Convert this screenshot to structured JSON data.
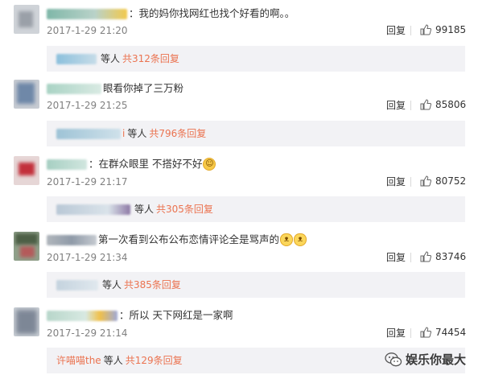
{
  "comments": [
    {
      "text": "：我的妈你找网红也找个好看的啊。。",
      "time": "2017-1-29 21:20",
      "reply_label": "回复",
      "likes": "99185",
      "replies": {
        "suffix": "等人",
        "count": "共312条回复",
        "visible_name": ""
      }
    },
    {
      "text": "眼看你掉了三万粉",
      "time": "2017-1-29 21:25",
      "reply_label": "回复",
      "likes": "85806",
      "replies": {
        "suffix": "等人",
        "count": "共796条回复",
        "visible_name": "i"
      }
    },
    {
      "text": "：在群众眼里 不搭好不好",
      "time": "2017-1-29 21:17",
      "reply_label": "回复",
      "likes": "80752",
      "replies": {
        "suffix": "等人",
        "count": "共305条回复",
        "visible_name": ""
      }
    },
    {
      "text": "第一次看到公布公布恋情评论全是骂声的",
      "time": "2017-1-29 21:34",
      "reply_label": "回复",
      "likes": "83746",
      "replies": {
        "suffix": "等人",
        "count": "共385条回复",
        "visible_name": ""
      }
    },
    {
      "text": "：所以 天下网红是一家啊",
      "time": "2017-1-29 21:14",
      "reply_label": "回复",
      "likes": "74454",
      "replies": {
        "suffix": "等人",
        "count": "共129条回复",
        "visible_name": "许喵喵the"
      }
    }
  ],
  "watermark": {
    "text": "娱乐你最大"
  },
  "icons": {
    "like": "thumbs-up-icon",
    "emoji": "smile-emoji-icon",
    "cat": "cat-face-emoji-icon",
    "watermark": "wechat-icon"
  },
  "colors": {
    "reply_count": "#eb7350",
    "timestamp": "#808080",
    "reply_bar_bg": "#f2f2f5"
  }
}
